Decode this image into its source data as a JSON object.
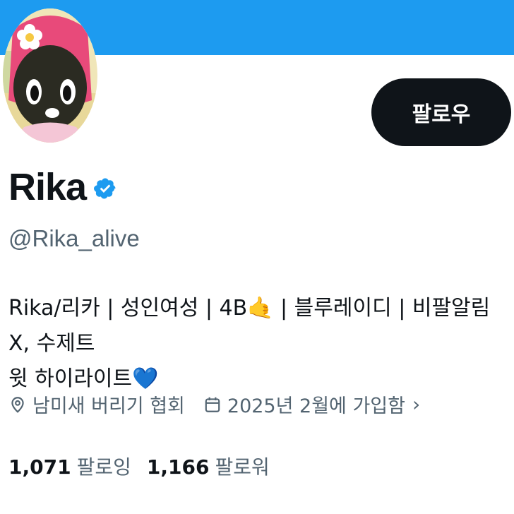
{
  "profile": {
    "display_name": "Rika",
    "handle": "@Rika_alive",
    "follow_label": "팔로우",
    "verified_color": "#1d9bf0",
    "bio_line1": "Rika/리카 | 성인여성 | 4B🤙 | 블루레이디 | 비팔알림 X, 수제트",
    "bio_line2": "윗 하이라이트💙",
    "location": "남미새 버리기 협회",
    "joined": "2025년 2월에 가입함",
    "following_count": "1,071",
    "following_label": "팔로잉",
    "followers_count": "1,166",
    "followers_label": "팔로워"
  },
  "icons": {
    "location": "location-pin-icon",
    "calendar": "calendar-icon",
    "verified": "verified-badge-icon",
    "chevron": "chevron-right-icon"
  },
  "colors": {
    "banner": "#1d9bf0",
    "follow_button": "#0f1419",
    "secondary_text": "#536471"
  }
}
